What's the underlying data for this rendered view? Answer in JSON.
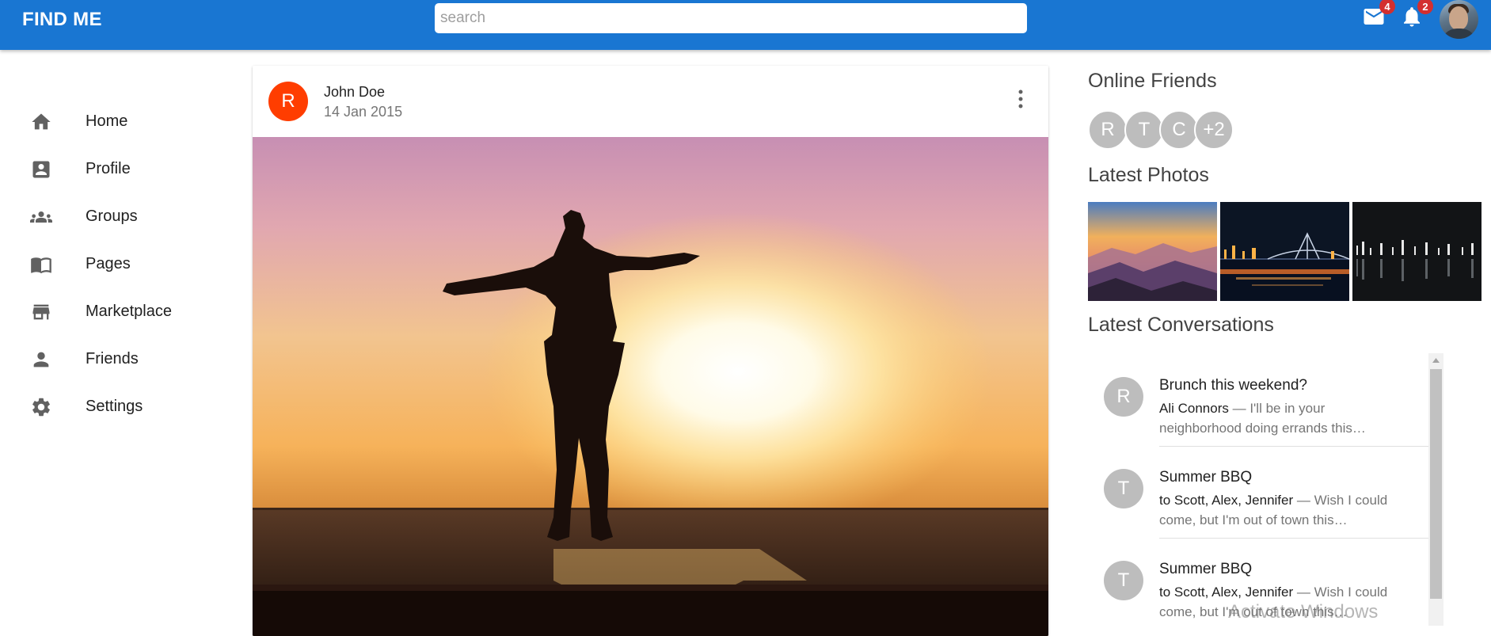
{
  "app": {
    "brand": "FIND ME"
  },
  "header": {
    "search_placeholder": "search",
    "mail_count": "4",
    "notification_count": "2"
  },
  "sidebar": {
    "items": [
      {
        "label": "Home",
        "icon": "home-icon"
      },
      {
        "label": "Profile",
        "icon": "account-box-icon"
      },
      {
        "label": "Groups",
        "icon": "groups-icon"
      },
      {
        "label": "Pages",
        "icon": "book-icon"
      },
      {
        "label": "Marketplace",
        "icon": "store-icon"
      },
      {
        "label": "Friends",
        "icon": "person-icon"
      },
      {
        "label": "Settings",
        "icon": "gear-icon"
      }
    ]
  },
  "post": {
    "avatar_letter": "R",
    "author": "John Doe",
    "date": "14 Jan 2015",
    "image": "sunset-silhouette-photo"
  },
  "right": {
    "online_friends_title": "Online Friends",
    "online_friends": [
      "R",
      "T",
      "C",
      "+2"
    ],
    "latest_photos_title": "Latest Photos",
    "photos": [
      "mountain-sunset-photo",
      "night-bridge-photo",
      "city-night-photo"
    ],
    "latest_conversations_title": "Latest Conversations",
    "conversations": [
      {
        "avatar": "R",
        "title": "Brunch this weekend?",
        "who": "Ali Connors",
        "preview": " — I'll be in your neighborhood doing errands this…"
      },
      {
        "avatar": "T",
        "title": "Summer BBQ",
        "who": "to Scott, Alex, Jennifer",
        "preview": " — Wish I could come, but I'm out of town this…"
      },
      {
        "avatar": "T",
        "title": "Summer BBQ",
        "who": "to Scott, Alex, Jennifer",
        "preview": " — Wish I could come, but I'm out of town this…"
      }
    ]
  },
  "system": {
    "watermark": "Activate Windows"
  },
  "colors": {
    "appbar": "#1976d2",
    "post_avatar": "#ff3d00",
    "badge": "#d32f2f",
    "chip": "#bdbdbd"
  }
}
